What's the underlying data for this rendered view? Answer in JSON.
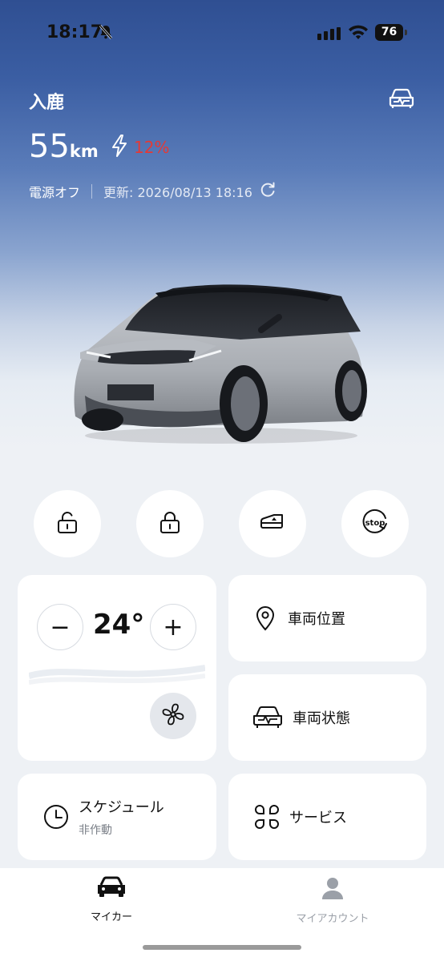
{
  "status_bar": {
    "time": "18:17",
    "battery_level": "76"
  },
  "vehicle": {
    "name": "入鹿",
    "range_value": "55",
    "range_unit": "km",
    "charge_percent": "12%",
    "power_state": "電源オフ",
    "updated": "更新: 2026/08/13 18:16"
  },
  "quick_actions": [
    {
      "name": "unlock",
      "icon": "unlock-icon"
    },
    {
      "name": "lock",
      "icon": "lock-icon"
    },
    {
      "name": "window",
      "icon": "window-icon"
    },
    {
      "name": "stop",
      "icon": "stop-icon",
      "label": "stop"
    }
  ],
  "climate": {
    "temperature": "24°",
    "decrease_label": "−",
    "increase_label": "+"
  },
  "tiles": {
    "location": "車両位置",
    "status": "車両状態",
    "schedule": "スケジュール",
    "schedule_state": "非作動",
    "services": "サービス"
  },
  "tabs": [
    {
      "label": "マイカー",
      "icon": "car-icon",
      "active": true
    },
    {
      "label": "マイアカウント",
      "icon": "account-icon",
      "active": false
    }
  ],
  "colors": {
    "accent_red": "#e53935",
    "header_blue": "#2f4f92",
    "active_tab": "#111111",
    "inactive_tab": "#9ba0a8"
  }
}
